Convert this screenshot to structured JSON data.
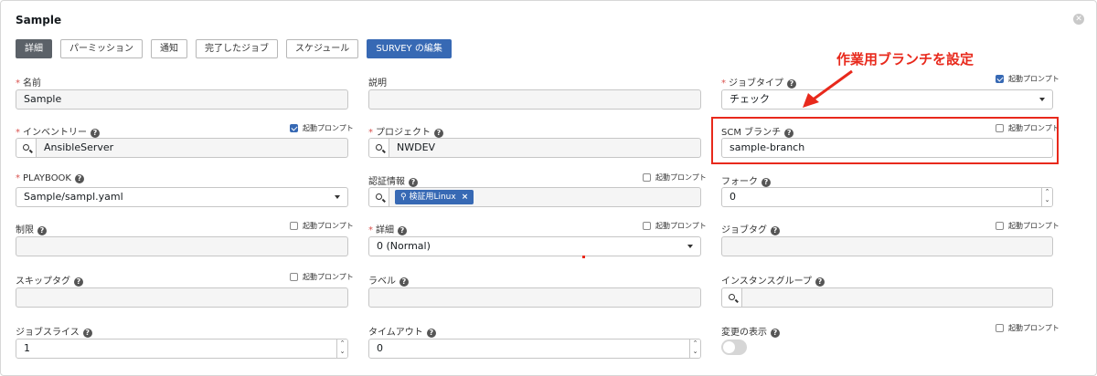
{
  "window": {
    "title": "Sample",
    "close_icon": "close-circle-icon"
  },
  "tabs": [
    "詳細",
    "パーミッション",
    "通知",
    "完了したジョブ",
    "スケジュール",
    "SURVEY の編集"
  ],
  "prompt_label": "起動プロンプト",
  "fields": {
    "name": {
      "label": "名前",
      "value": "Sample"
    },
    "description": {
      "label": "説明",
      "value": ""
    },
    "job_type": {
      "label": "ジョブタイプ",
      "value": "チェック",
      "prompt_checked": true
    },
    "inventory": {
      "label": "インベントリー",
      "value": "AnsibleServer",
      "prompt_checked": true
    },
    "project": {
      "label": "プロジェクト",
      "value": "NWDEV"
    },
    "scm_branch": {
      "label": "SCM ブランチ",
      "value": "sample-branch",
      "prompt_checked": false
    },
    "playbook": {
      "label": "PLAYBOOK",
      "value": "Sample/sampl.yaml"
    },
    "credentials": {
      "label": "認証情報",
      "chip": "検証用Linux",
      "prompt_checked": false
    },
    "forks": {
      "label": "フォーク",
      "value": "0"
    },
    "limit": {
      "label": "制限",
      "value": "",
      "prompt_checked": false
    },
    "verbosity": {
      "label": "詳細",
      "value": "0 (Normal)",
      "prompt_checked": false
    },
    "job_tags": {
      "label": "ジョブタグ",
      "value": "",
      "prompt_checked": false
    },
    "skip_tags": {
      "label": "スキップタグ",
      "value": "",
      "prompt_checked": false
    },
    "labels": {
      "label": "ラベル",
      "value": ""
    },
    "instance_groups": {
      "label": "インスタンスグループ",
      "value": ""
    },
    "job_slicing": {
      "label": "ジョブスライス",
      "value": "1"
    },
    "timeout": {
      "label": "タイムアウト",
      "value": "0"
    },
    "show_changes": {
      "label": "変更の表示",
      "enabled": false,
      "prompt_checked": false
    }
  },
  "annotation": {
    "text": "作業用ブランチを設定",
    "color": "#e8291c"
  },
  "colors": {
    "primary": "#3769b4",
    "active_tab": "#5b6168",
    "required": "#d9534f",
    "annotation": "#e8291c"
  }
}
